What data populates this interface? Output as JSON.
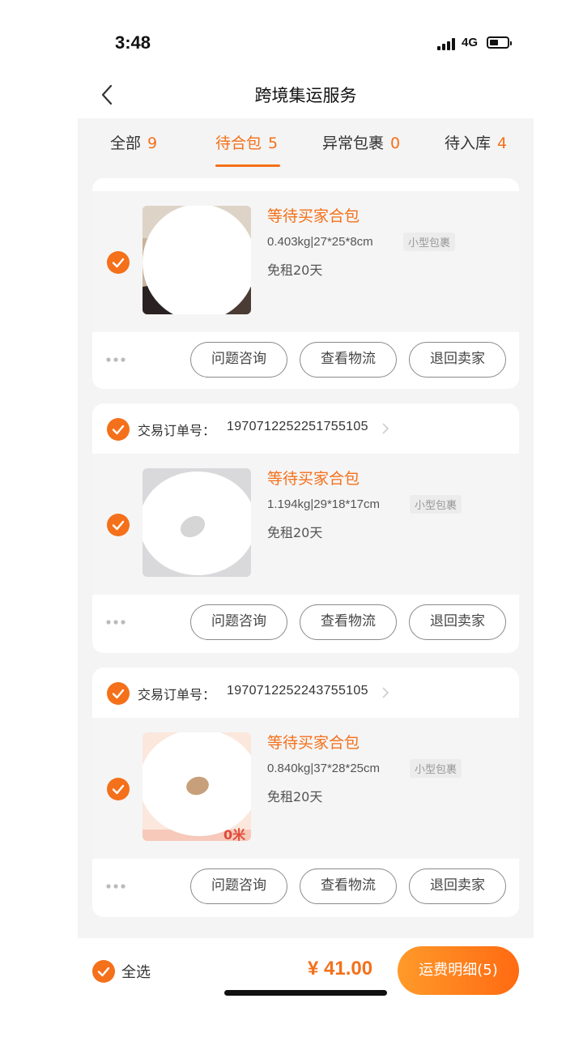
{
  "status_bar": {
    "time": "3:48",
    "network": "4G",
    "battery_percent": 50
  },
  "nav": {
    "title": "跨境集运服务",
    "back_icon": "chevron-left-icon"
  },
  "tabs": [
    {
      "label": "全部",
      "count": "9",
      "active": false
    },
    {
      "label": "待合包",
      "count": "5",
      "active": true
    },
    {
      "label": "异常包裹",
      "count": "0",
      "active": false
    },
    {
      "label": "待入库",
      "count": "4",
      "active": false
    }
  ],
  "order_label": "交易订单号：",
  "packages": [
    {
      "order_no": "",
      "status": "等待买家合包",
      "spec": "0.403kg|27*25*8cm",
      "tag": "小型包裹",
      "free_rent": "免租20天",
      "checked": true
    },
    {
      "order_no": "1970712252251755105",
      "status": "等待买家合包",
      "spec": "1.194kg|29*18*17cm",
      "tag": "小型包裹",
      "free_rent": "免租20天",
      "checked": true
    },
    {
      "order_no": "1970712252243755105",
      "status": "等待买家合包",
      "spec": "0.840kg|37*28*25cm",
      "tag": "小型包裹",
      "free_rent": "免租20天",
      "checked": true
    }
  ],
  "actions": {
    "consult": "问题咨询",
    "logistics": "查看物流",
    "return": "退回卖家"
  },
  "thumb_text": "0米",
  "bottom": {
    "select_all": "全选",
    "total": "¥ 41.00",
    "detail_button": "运费明细(5)"
  },
  "colors": {
    "accent": "#f4701a",
    "background": "#f4f4f4"
  }
}
